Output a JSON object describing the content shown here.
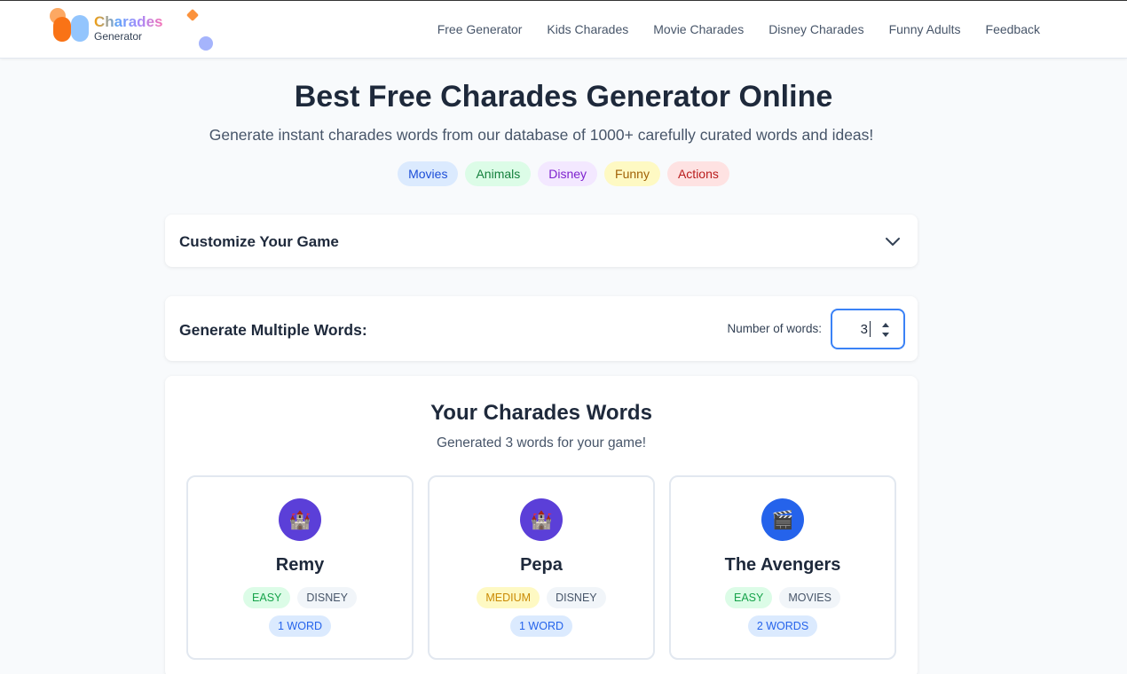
{
  "header": {
    "logo_line1": "Charades",
    "logo_line2": "Generator",
    "nav": [
      "Free Generator",
      "Kids Charades",
      "Movie Charades",
      "Disney Charades",
      "Funny Adults",
      "Feedback"
    ]
  },
  "hero": {
    "title": "Best Free Charades Generator Online",
    "subtitle": "Generate instant charades words from our database of 1000+ carefully curated words and ideas!",
    "chips": [
      {
        "label": "Movies",
        "bg": "#dbeafe",
        "fg": "#1d4ed8"
      },
      {
        "label": "Animals",
        "bg": "#dcfce7",
        "fg": "#15803d"
      },
      {
        "label": "Disney",
        "bg": "#f3e8ff",
        "fg": "#7e22ce"
      },
      {
        "label": "Funny",
        "bg": "#fef9c3",
        "fg": "#a16207"
      },
      {
        "label": "Actions",
        "bg": "#fee2e2",
        "fg": "#b91c1c"
      }
    ]
  },
  "customize": {
    "label": "Customize Your Game",
    "icon": "chevron-down-icon"
  },
  "multiple": {
    "label": "Generate Multiple Words:",
    "count_label": "Number of words:",
    "count_value": "3"
  },
  "results": {
    "title": "Your Charades Words",
    "subtitle": "Generated 3 words for your game!",
    "cards": [
      {
        "icon": "castle-icon",
        "glyph": "🏰",
        "icon_bg": "#5b3fd8",
        "word": "Remy",
        "difficulty": "EASY",
        "difficulty_bg": "#dcfce7",
        "difficulty_fg": "#16a34a",
        "category": "DISNEY",
        "length": "1 WORD"
      },
      {
        "icon": "castle-icon",
        "glyph": "🏰",
        "icon_bg": "#5b3fd8",
        "word": "Pepa",
        "difficulty": "MEDIUM",
        "difficulty_bg": "#fef9c3",
        "difficulty_fg": "#ca8a04",
        "category": "DISNEY",
        "length": "1 WORD"
      },
      {
        "icon": "clapperboard-icon",
        "glyph": "🎬",
        "icon_bg": "#2563eb",
        "word": "The Avengers",
        "difficulty": "EASY",
        "difficulty_bg": "#dcfce7",
        "difficulty_fg": "#16a34a",
        "category": "MOVIES",
        "length": "2 WORDS"
      }
    ]
  }
}
